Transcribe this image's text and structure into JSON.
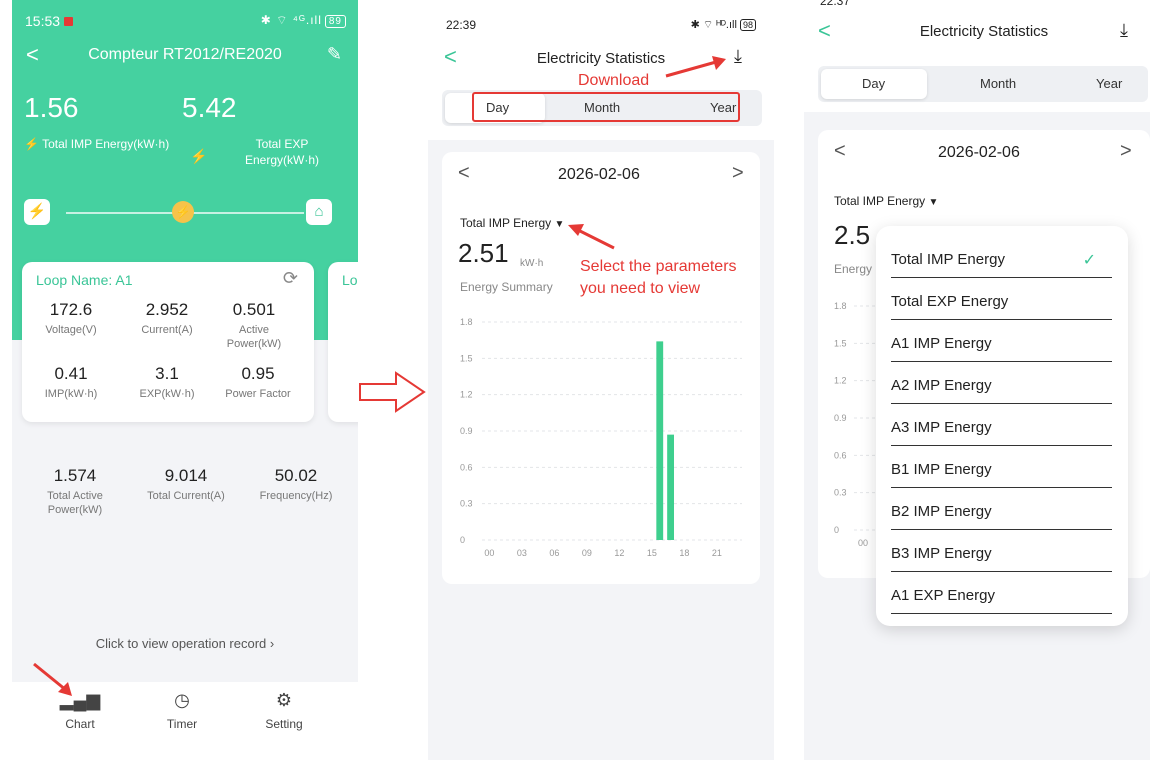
{
  "panel1": {
    "status_time": "15:53",
    "status_icons": "✱ ⌔ ⁴ᴳ.ıll",
    "battery": "89",
    "title": "Compteur RT2012/RE2020",
    "total_imp_value": "1.56",
    "total_imp_label": "Total IMP Energy(kW·h)",
    "total_exp_value": "5.42",
    "total_exp_label_1": "Total EXP",
    "total_exp_label_2": "Energy(kW·h)",
    "loop_name": "Loop Name: A1",
    "next_card_peek": "Lo",
    "metrics": [
      {
        "value": "172.6",
        "label": "Voltage(V)"
      },
      {
        "value": "2.952",
        "label": "Current(A)"
      },
      {
        "value": "0.501",
        "label": "Active Power(kW)"
      },
      {
        "value": "0.41",
        "label": "IMP(kW·h)"
      },
      {
        "value": "3.1",
        "label": "EXP(kW·h)"
      },
      {
        "value": "0.95",
        "label": "Power Factor"
      }
    ],
    "totals": [
      {
        "value": "1.574",
        "label": "Total Active Power(kW)"
      },
      {
        "value": "9.014",
        "label": "Total Current(A)"
      },
      {
        "value": "50.02",
        "label": "Frequency(Hz)"
      }
    ],
    "record_link": "Click to view operation record",
    "tabs": [
      {
        "label": "Chart",
        "icon": "chart-icon"
      },
      {
        "label": "Timer",
        "icon": "clock-icon"
      },
      {
        "label": "Setting",
        "icon": "gear-icon"
      }
    ],
    "accent": "#45d1a0"
  },
  "panel2": {
    "status_time": "22:39",
    "battery": "98",
    "title": "Electricity Statistics",
    "annotation_download": "Download",
    "segments": [
      "Day",
      "Month",
      "Year"
    ],
    "selected_segment": "Day",
    "date": "2026-02-06",
    "param": "Total IMP Energy",
    "value": "2.51",
    "unit": "kW·h",
    "summary": "Energy Summary",
    "annotation_select_1": "Select the parameters",
    "annotation_select_2": "you need to view",
    "chart_data": {
      "type": "bar",
      "x_ticks": [
        "00",
        "03",
        "06",
        "09",
        "12",
        "15",
        "18",
        "21"
      ],
      "y_ticks": [
        "0",
        "0.3",
        "0.6",
        "0.9",
        "1.2",
        "1.5",
        "1.8"
      ],
      "ylim": [
        0,
        1.8
      ],
      "categories": [
        "16",
        "17"
      ],
      "values": [
        1.64,
        0.87
      ],
      "bar_color": "#3ecf8e"
    }
  },
  "panel3": {
    "status_time": "22:37",
    "title": "Electricity Statistics",
    "segments": [
      "Day",
      "Month",
      "Year"
    ],
    "selected_segment": "Day",
    "date": "2026-02-06",
    "param": "Total IMP Energy",
    "value_partial": "2.5",
    "summary_partial": "Energy",
    "y_ticks": [
      "0",
      "0.3",
      "0.6",
      "0.9",
      "1.2",
      "1.5",
      "1.8"
    ],
    "x_tick_partial": "00",
    "dropdown_options": [
      "Total IMP Energy",
      "Total EXP Energy",
      "A1 IMP Energy",
      "A2 IMP Energy",
      "A3 IMP Energy",
      "B1 IMP Energy",
      "B2 IMP Energy",
      "B3 IMP Energy",
      "A1 EXP Energy"
    ],
    "selected_option": "Total IMP Energy"
  }
}
